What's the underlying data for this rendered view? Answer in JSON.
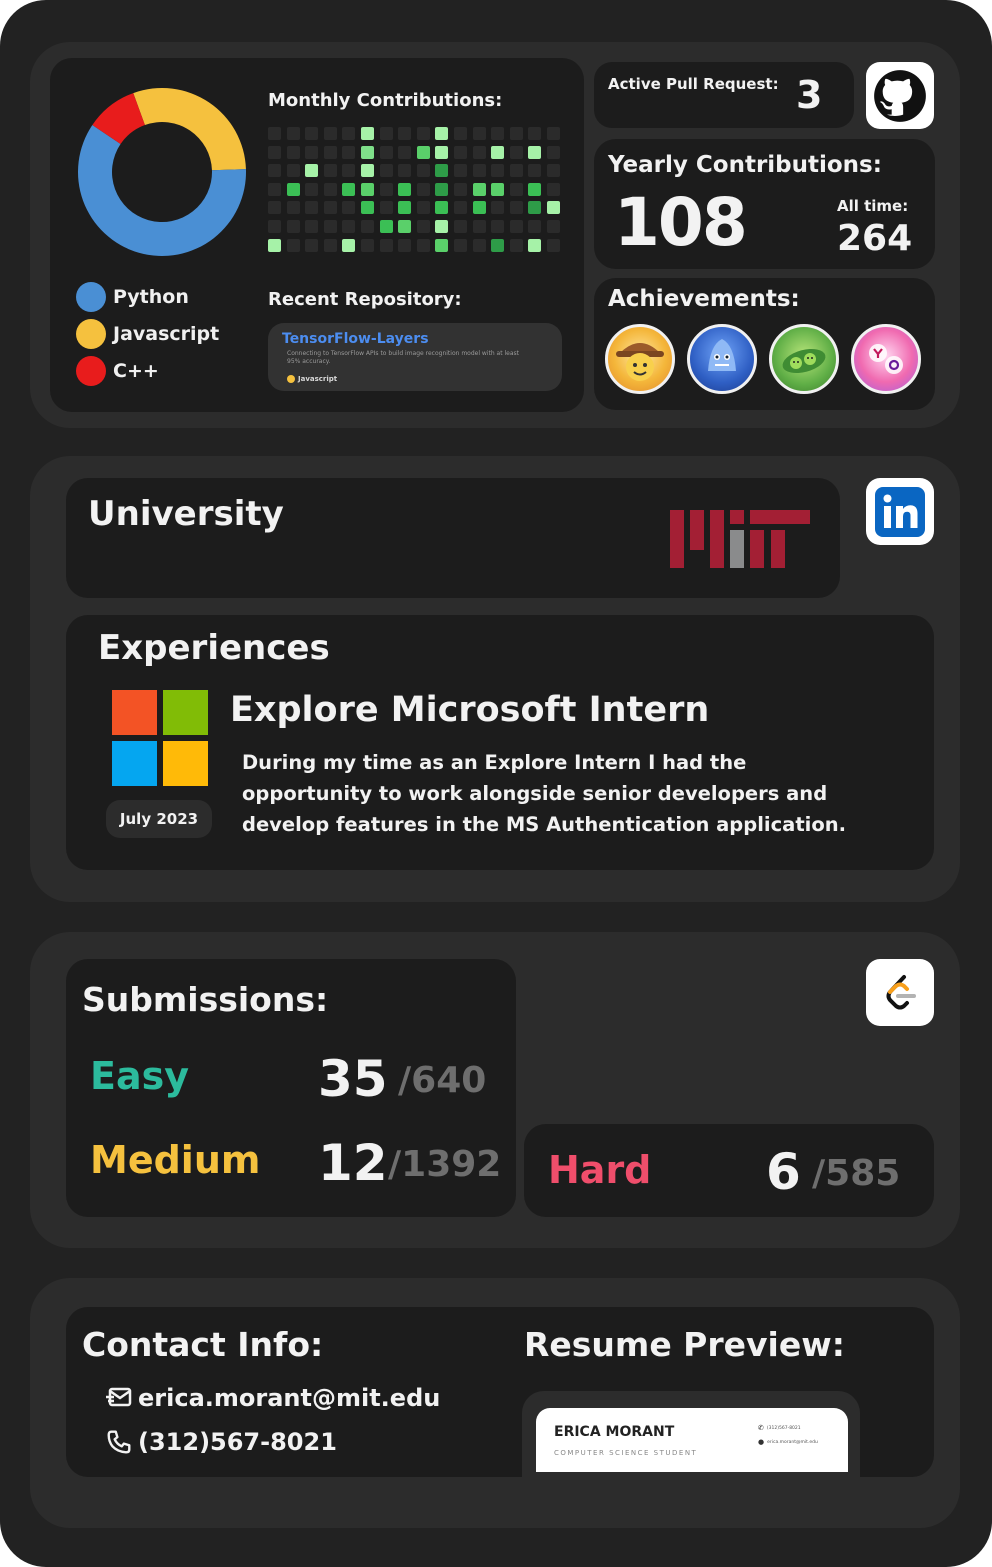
{
  "github": {
    "active_pr_label": "Active Pull Request:",
    "active_pr_value": "3",
    "yearly_label": "Yearly Contributions:",
    "yearly_value": "108",
    "all_time_label": "All time:",
    "all_time_value": "264",
    "monthly_label": "Monthly Contributions:",
    "recent_repo_label": "Recent Repository:",
    "repo": {
      "name": "TensorFlow-Layers",
      "description": "Connecting to TensorFlow APIs to build image recognition model with at least 95% accuracy.",
      "language": "Javascript"
    },
    "languages": [
      {
        "name": "Python",
        "color": "#4a8fd4",
        "share": 0.6
      },
      {
        "name": "Javascript",
        "color": "#f5c13e",
        "share": 0.3
      },
      {
        "name": "C++",
        "color": "#e81c1c",
        "share": 0.1
      }
    ],
    "achievements_label": "Achievements:",
    "achievements": [
      {
        "name": "cowboy-badge",
        "color": "#f2b233"
      },
      {
        "name": "shark-badge",
        "color": "#2f5fc4"
      },
      {
        "name": "peas-badge",
        "color": "#5fae46"
      },
      {
        "name": "yolo-badge",
        "color": "#f06ab0"
      }
    ]
  },
  "education": {
    "university_label": "University",
    "experiences_label": "Experiences",
    "job_title": "Explore Microsoft Intern",
    "date": "July 2023",
    "description_lines": [
      "During my time as an Explore Intern I had the",
      "opportunity to work alongside senior developers and",
      "develop features in the MS Authentication application."
    ]
  },
  "leetcode": {
    "submissions_label": "Submissions:",
    "easy": {
      "label": "Easy",
      "solved": "35",
      "total": "/640",
      "color": "#2cbb9d"
    },
    "medium": {
      "label": "Medium",
      "solved": "12",
      "total": "/1392",
      "color": "#f5c13e"
    },
    "hard": {
      "label": "Hard",
      "solved": "6",
      "total": "/585",
      "color": "#ef4e6b"
    }
  },
  "contact": {
    "contact_label": "Contact Info:",
    "email": "erica.morant@mit.edu",
    "phone": "(312)567-8021",
    "resume_label": "Resume Preview:",
    "resume_name": "ERICA MORANT",
    "resume_subtitle": "COMPUTER SCIENCE STUDENT",
    "resume_phone": "(312)567-8021",
    "resume_email": "erica.morant@mit.edu"
  }
}
